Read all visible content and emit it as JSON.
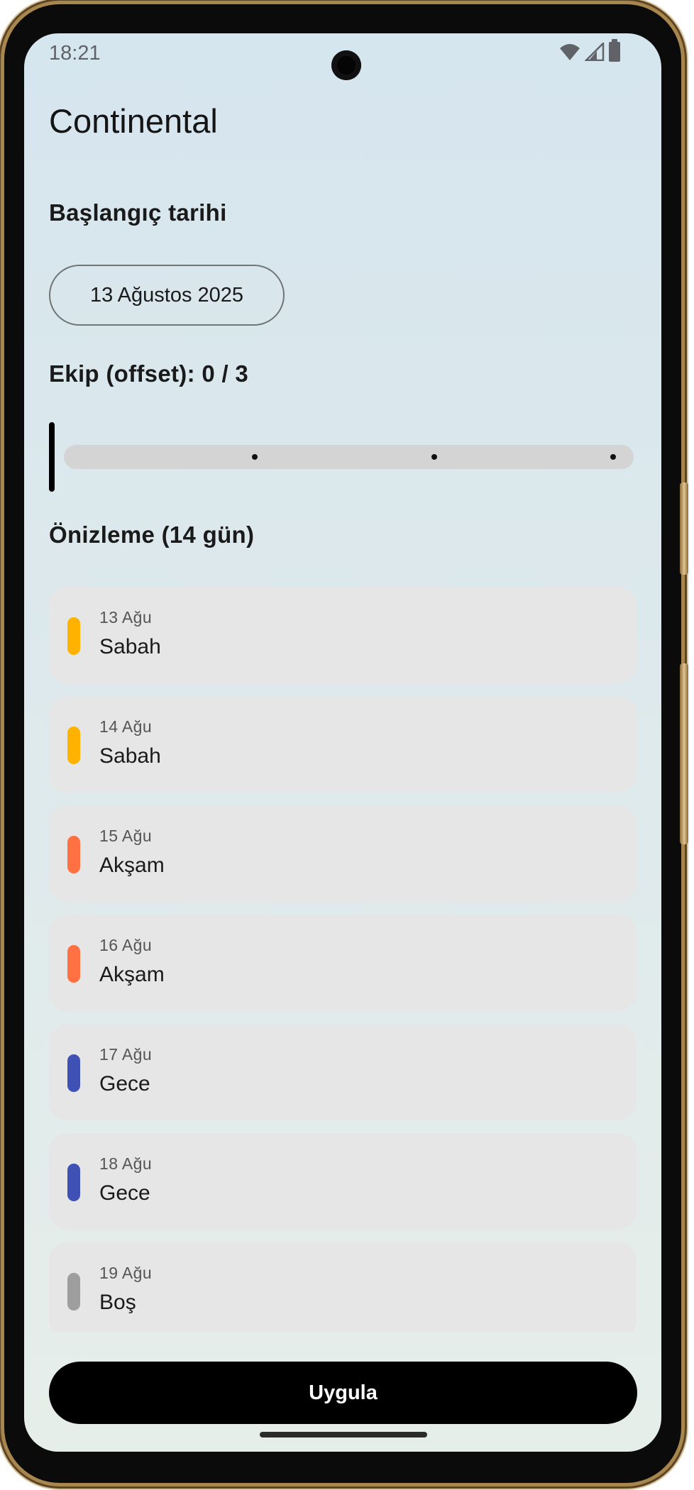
{
  "status_bar": {
    "time": "18:21",
    "icons": [
      "wifi-icon",
      "cellular-signal-icon",
      "battery-icon"
    ]
  },
  "app": {
    "title": "Continental"
  },
  "start_date": {
    "label": "Başlangıç tarihi",
    "value": "13 Ağustos 2025"
  },
  "team_offset": {
    "label": "Ekip (offset): 0 / 3",
    "value": 0,
    "min": 0,
    "max": 3
  },
  "preview": {
    "label": "Önizleme (14 gün)",
    "days": [
      {
        "date": "13 Ağu",
        "shift": "Sabah",
        "color": "#FFB300"
      },
      {
        "date": "14 Ağu",
        "shift": "Sabah",
        "color": "#FFB300"
      },
      {
        "date": "15 Ağu",
        "shift": "Akşam",
        "color": "#FF7043"
      },
      {
        "date": "16 Ağu",
        "shift": "Akşam",
        "color": "#FF7043"
      },
      {
        "date": "17 Ağu",
        "shift": "Gece",
        "color": "#3F51B5"
      },
      {
        "date": "18 Ağu",
        "shift": "Gece",
        "color": "#3F51B5"
      },
      {
        "date": "19 Ağu",
        "shift": "Boş",
        "color": "#9E9E9E"
      }
    ]
  },
  "apply_button": {
    "label": "Uygula"
  }
}
